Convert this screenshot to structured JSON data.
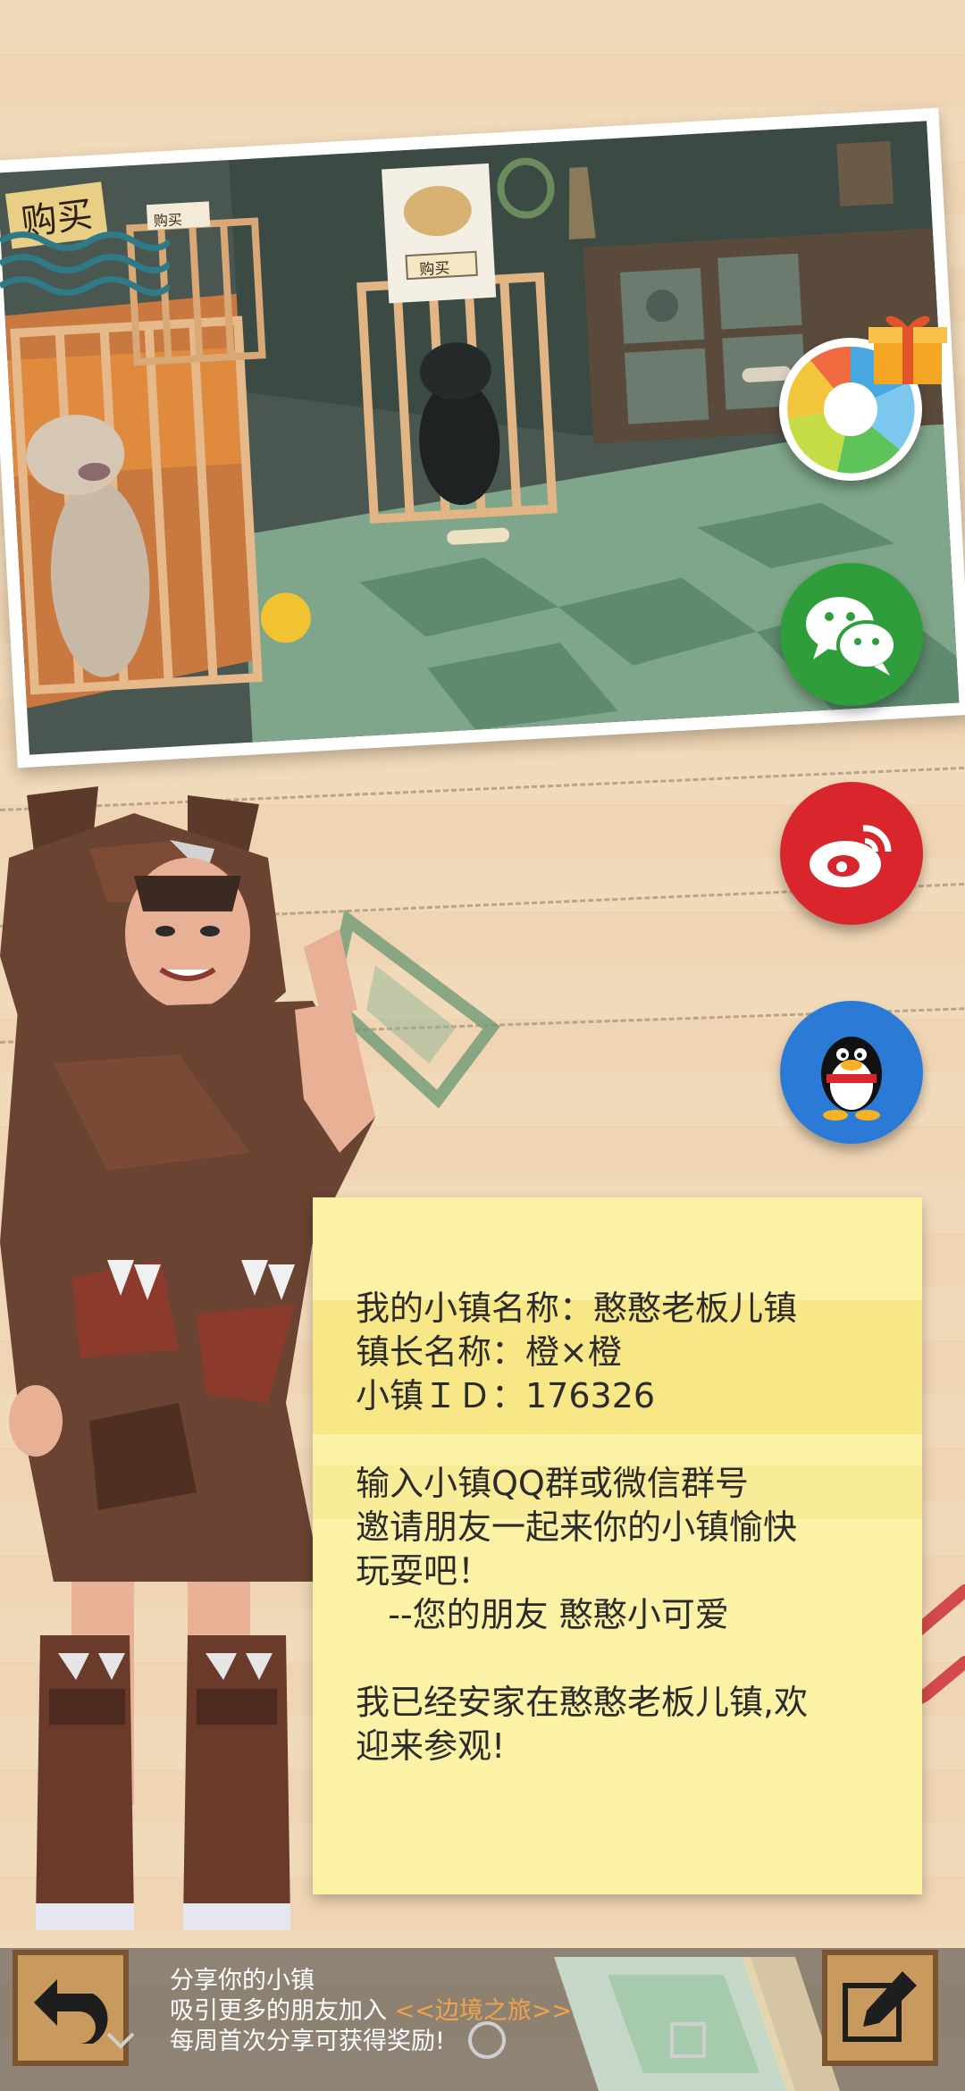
{
  "photo": {
    "sign_buy_large": "购买",
    "sign_buy_small": "购买",
    "sign_buy_center": "购买"
  },
  "share": {
    "icons": [
      "camera-shutter-icon",
      "gift-icon",
      "wechat-icon",
      "weibo-icon",
      "qq-icon"
    ],
    "colors": {
      "wechat": "#2f9e3a",
      "weibo": "#d8262c",
      "qq": "#2b7bd6"
    }
  },
  "note": {
    "town_name_line": "我的小镇名称：憨憨老板儿镇",
    "mayor_line": "镇长名称：橙×橙",
    "town_id_line": "小镇ＩＤ：176326",
    "invite_line1": "输入小镇QQ群或微信群号",
    "invite_line2": "邀请朋友一起来你的小镇愉快",
    "invite_line3": "玩耍吧！",
    "signature": "   --您的朋友 憨憨小可爱",
    "settled_line1": "我已经安家在憨憨老板儿镇,欢",
    "settled_line2": "迎来参观!"
  },
  "bottom": {
    "share_title": "分享你的小镇",
    "attract_prefix": "吸引更多的朋友加入 ",
    "attract_highlight": "<<边境之旅>>",
    "reward_text": "每周首次分享可获得奖励!"
  }
}
